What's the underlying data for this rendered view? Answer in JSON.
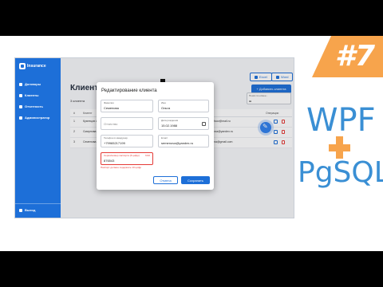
{
  "app": {
    "brand": "Insurance",
    "nav": [
      "Договоры",
      "Клиенты",
      "Отчетность",
      "Администратор"
    ],
    "logout": "Выход"
  },
  "toolbar": {
    "excel": "Excel",
    "word": "Word",
    "add_client": "+ Добавить клиента"
  },
  "main": {
    "title": "Клиенты",
    "count": "3 клиента",
    "search": {
      "label": "Поиск по клиен...",
      "value": "ш"
    }
  },
  "table": {
    "headers": [
      "#",
      "Клиент",
      "Email",
      "Операции"
    ],
    "rows": [
      {
        "num": "1",
        "name": "Кузнецов А...",
        "email": "...kuznetsov@mail.ru"
      },
      {
        "num": "2",
        "name": "Смирнова Д...",
        "email": "...smirnova@yandex.ru"
      },
      {
        "num": "3",
        "name": "Семенова Г...",
        "email": "...akhalina@gmail.com"
      }
    ]
  },
  "dialog": {
    "title": "Редактирование клиента",
    "fields": {
      "lastname": {
        "label": "Фамилия",
        "value": "Семенова"
      },
      "firstname": {
        "label": "Имя",
        "value": "Ольга"
      },
      "patronymic": {
        "label": "",
        "value": "Отчество"
      },
      "birthdate": {
        "label": "Дата рождения",
        "value": "15.02.1988"
      },
      "phone": {
        "label": "Телефон в междунар.",
        "value": "+79965217199"
      },
      "email": {
        "label": "Email",
        "value": "semenova@yandex.ru"
      },
      "passport": {
        "label": "Серия/номер паспорта (6 цифр)",
        "value": "876543",
        "counter": "6/10"
      }
    },
    "error": "Паспорт должен содержать 10 цифр",
    "cancel": "Отмена",
    "save": "Сохранить"
  },
  "overlay": {
    "episode": "#7",
    "tech1": "WPF",
    "plus": "+",
    "tech2": "PgSQL"
  },
  "colors": {
    "accent": "#1d6fd8",
    "badge": "#f7a44c",
    "title_text": "#3a8fd4",
    "error": "#e53935"
  }
}
